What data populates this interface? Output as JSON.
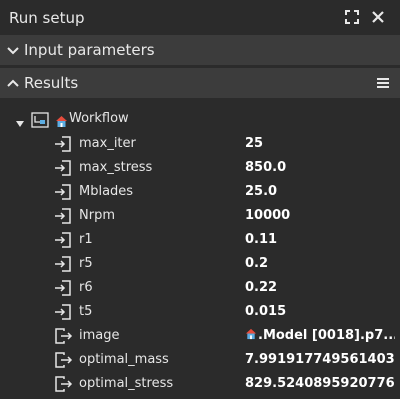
{
  "window": {
    "title": "Run setup"
  },
  "sections": {
    "input": {
      "label": "Input parameters",
      "expanded": false
    },
    "results": {
      "label": "Results",
      "expanded": true
    }
  },
  "tree": {
    "root": {
      "label": "Workflow",
      "icon": "workflow-icon"
    },
    "inputs": [
      {
        "key": "max_iter",
        "value": "25"
      },
      {
        "key": "max_stress",
        "value": "850.0"
      },
      {
        "key": "Mblades",
        "value": "25.0"
      },
      {
        "key": "Nrpm",
        "value": "10000"
      },
      {
        "key": "r1",
        "value": "0.11"
      },
      {
        "key": "r5",
        "value": "0.2"
      },
      {
        "key": "r6",
        "value": "0.22"
      },
      {
        "key": "t5",
        "value": "0.015"
      }
    ],
    "outputs": [
      {
        "key": "image",
        "value": ".Model [0018].p7..."
      },
      {
        "key": "optimal_mass",
        "value": "7.991917749561403"
      },
      {
        "key": "optimal_stress",
        "value": "829.5240895920776"
      }
    ]
  },
  "colors": {
    "background": "#2b2b2b",
    "section_bar": "#3c3c3c",
    "text": "#e6e6e6",
    "home_roof": "#e74c3c",
    "home_body": "#5dade2"
  }
}
